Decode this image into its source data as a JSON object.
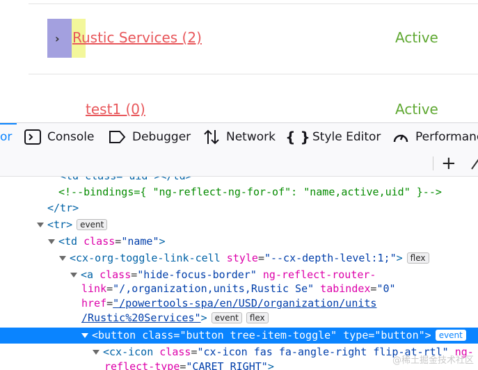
{
  "page": {
    "rows": [
      {
        "link": "Rustic Services (2)",
        "status": "Active"
      },
      {
        "link": "test1 (0)",
        "status": "Active"
      }
    ],
    "chevron": "›"
  },
  "devtools": {
    "tabs": [
      {
        "label": "or",
        "icon": "inspector-icon"
      },
      {
        "label": "Console",
        "icon": "console-icon"
      },
      {
        "label": "Debugger",
        "icon": "debugger-icon"
      },
      {
        "label": "Network",
        "icon": "network-icon"
      },
      {
        "label": "Style Editor",
        "icon": "style-editor-icon"
      },
      {
        "label": "Performanc",
        "icon": "performance-icon"
      }
    ],
    "add_node": "+",
    "lines": {
      "l0": "<td class=\"uid\"></td>",
      "l1": "<!--bindings={ \"ng-reflect-ng-for-of\": \"name,active,uid\" }-->",
      "l2_tag": "</tr>",
      "l3_tag": "<tr>",
      "l4_tag": "<td",
      "l4_attr": "class",
      "l4_val": "\"name\"",
      "l5_tag": "<cx-org-toggle-link-cell",
      "l5_attr": "style",
      "l5_val": "\"--cx-depth-level:1;\"",
      "l6_tag": "<a",
      "l6_attr1": "class",
      "l6_val1": "\"hide-focus-border\"",
      "l6_attr2": "ng-reflect-router-",
      "l7_attr1": "link",
      "l7_val1": "\"/,organization,units,Rustic Se\"",
      "l7_attr2": "tabindex",
      "l7_val2": "\"0\"",
      "l8_attr": "href",
      "l8_val": "\"/powertools-spa/en/USD/organization/units",
      "l9_val": "/Rustic%20Services\"",
      "l10_tag": "<button",
      "l10_attr1": "class",
      "l10_val1": "\"button tree-item-toggle\"",
      "l10_attr2": "type",
      "l10_val2": "\"button\"",
      "l11_tag": "<cx-icon",
      "l11_attr1": "class",
      "l11_val1": "\"cx-icon fas fa-angle-right flip-at-rtl\"",
      "l11_attr2": "ng-",
      "l12_attr": "reflect-type",
      "l12_val": "\"CARET_RIGHT\""
    },
    "badges": {
      "event": "event",
      "flex": "flex"
    }
  },
  "watermark": "@稀土掘金技术社区"
}
